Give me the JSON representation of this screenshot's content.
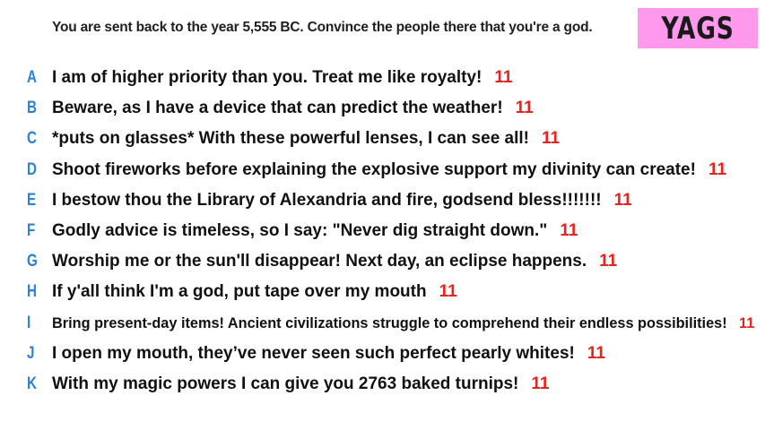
{
  "prompt": "You are sent back to the year 5,555 BC. Convince the people there that you're a god.",
  "logo": "YAGS",
  "answers": [
    {
      "letter": "A",
      "text": "I am of higher priority than you. Treat me like royalty!",
      "score": "11"
    },
    {
      "letter": "B",
      "text": "Beware, as I have a device that can predict the weather!",
      "score": "11"
    },
    {
      "letter": "C",
      "text": "*puts on glasses* With these powerful lenses, I can see all!",
      "score": "11"
    },
    {
      "letter": "D",
      "text": "Shoot fireworks before explaining the explosive support my divinity can create!",
      "score": "11"
    },
    {
      "letter": "E",
      "text": "I bestow thou the Library of Alexandria and fire, godsend bless!!!!!!!",
      "score": "11"
    },
    {
      "letter": "F",
      "text": "Godly advice is timeless, so I say: \"Never dig straight down.\"",
      "score": "11"
    },
    {
      "letter": "G",
      "text": "Worship me or the sun'll disappear! Next day, an eclipse happens.",
      "score": "11"
    },
    {
      "letter": "H",
      "text": "If y'all think I'm a god, put tape over my mouth",
      "score": "11"
    },
    {
      "letter": "I",
      "text": "Bring present-day items! Ancient civilizations struggle to comprehend their endless possibilities!",
      "score": "11"
    },
    {
      "letter": "J",
      "text": "I open my mouth, they’ve never seen such perfect pearly whites!",
      "score": "11"
    },
    {
      "letter": "K",
      "text": "With my magic powers I can give you 2763 baked turnips!",
      "score": "11"
    }
  ]
}
